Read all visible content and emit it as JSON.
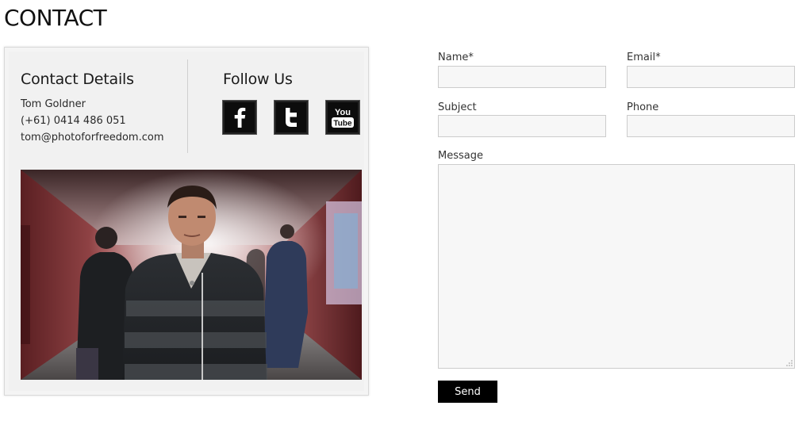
{
  "page": {
    "title": "CONTACT"
  },
  "contact_details": {
    "heading": "Contact Details",
    "name": "Tom Goldner",
    "phone": "(+61) 0414 486 051",
    "email": "tom@photoforfreedom.com"
  },
  "follow_us": {
    "heading": "Follow Us",
    "icons": [
      {
        "name": "facebook-icon",
        "glyph": "f"
      },
      {
        "name": "twitter-icon",
        "glyph": "t"
      },
      {
        "name": "youtube-icon",
        "glyph_top": "You",
        "glyph_bottom": "Tube"
      }
    ]
  },
  "form": {
    "name_label": "Name*",
    "email_label": "Email*",
    "subject_label": "Subject",
    "phone_label": "Phone",
    "message_label": "Message",
    "name_value": "",
    "email_value": "",
    "subject_value": "",
    "phone_value": "",
    "message_value": "",
    "send_label": "Send"
  },
  "colors": {
    "card_bg": "#f4f4f4",
    "input_bg": "#f7f7f7",
    "input_border": "#cccccc",
    "button_bg": "#000000",
    "button_text": "#ffffff"
  }
}
